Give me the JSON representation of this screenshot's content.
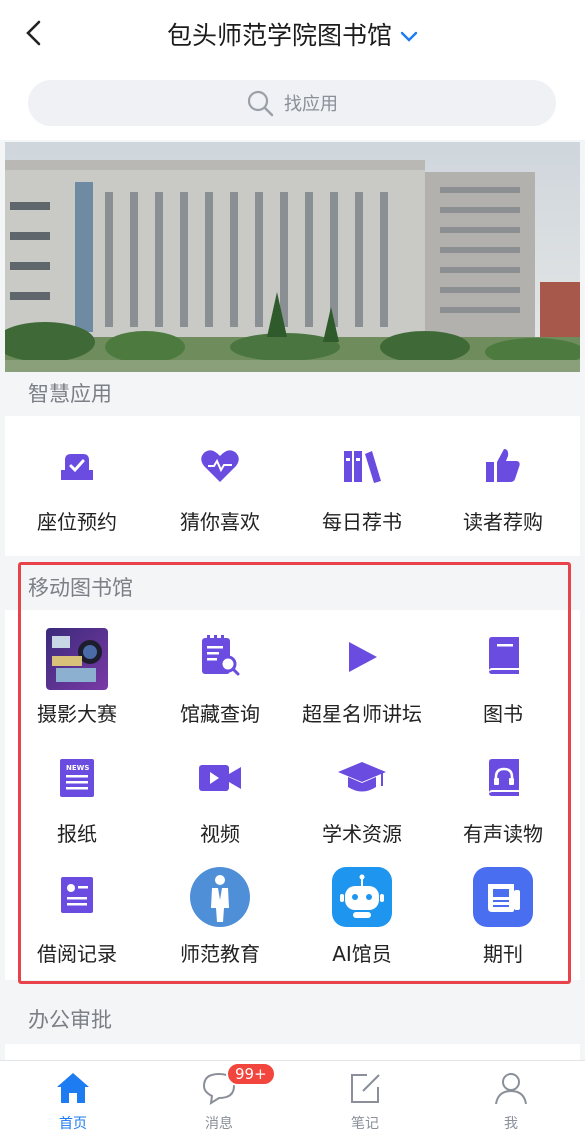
{
  "header": {
    "title": "包头师范学院图书馆"
  },
  "search": {
    "placeholder": "找应用"
  },
  "sections": {
    "smart": {
      "title": "智慧应用",
      "items": [
        {
          "label": "座位预约",
          "icon": "seat-icon"
        },
        {
          "label": "猜你喜欢",
          "icon": "heart-icon"
        },
        {
          "label": "每日荐书",
          "icon": "books-icon"
        },
        {
          "label": "读者荐购",
          "icon": "thumbs-up-icon"
        }
      ]
    },
    "mobile": {
      "title": "移动图书馆",
      "items": [
        {
          "label": "摄影大赛",
          "icon": "photo-contest-icon"
        },
        {
          "label": "馆藏查询",
          "icon": "catalog-search-icon"
        },
        {
          "label": "超星名师讲坛",
          "icon": "play-icon"
        },
        {
          "label": "图书",
          "icon": "book-icon"
        },
        {
          "label": "报纸",
          "icon": "newspaper-icon"
        },
        {
          "label": "视频",
          "icon": "video-icon"
        },
        {
          "label": "学术资源",
          "icon": "graduation-cap-icon"
        },
        {
          "label": "有声读物",
          "icon": "audiobook-icon"
        },
        {
          "label": "借阅记录",
          "icon": "borrow-record-icon"
        },
        {
          "label": "师范教育",
          "icon": "teacher-icon"
        },
        {
          "label": "AI馆员",
          "icon": "robot-icon"
        },
        {
          "label": "期刊",
          "icon": "journal-icon"
        }
      ]
    },
    "office": {
      "title": "办公审批"
    }
  },
  "tabbar": {
    "items": [
      {
        "label": "首页",
        "icon": "home-icon",
        "active": true
      },
      {
        "label": "消息",
        "icon": "message-icon"
      },
      {
        "label": "笔记",
        "icon": "note-icon"
      },
      {
        "label": "我",
        "icon": "profile-icon"
      }
    ],
    "message_badge": "99+"
  },
  "colors": {
    "accent": "#1e7cf2",
    "icon_purple": "#6a4de0",
    "highlight": "#e8434a",
    "badge": "#f2453d"
  }
}
